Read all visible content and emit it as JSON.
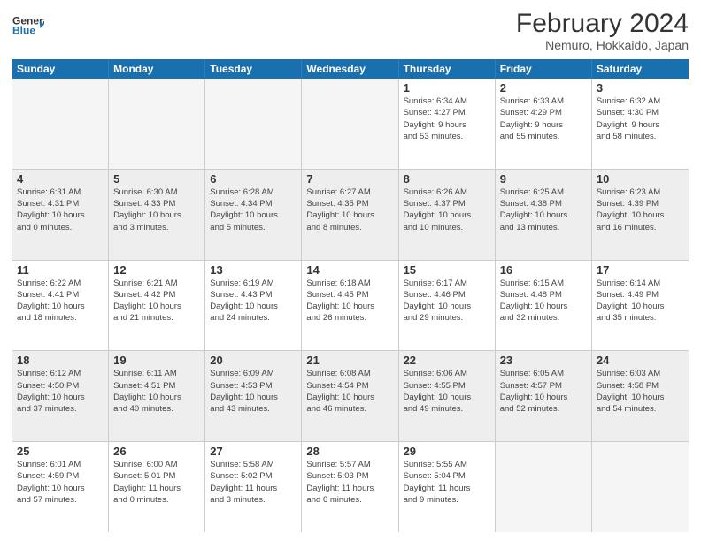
{
  "header": {
    "logo_general": "General",
    "logo_blue": "Blue",
    "title": "February 2024",
    "subtitle": "Nemuro, Hokkaido, Japan"
  },
  "calendar": {
    "days_of_week": [
      "Sunday",
      "Monday",
      "Tuesday",
      "Wednesday",
      "Thursday",
      "Friday",
      "Saturday"
    ],
    "weeks": [
      [
        {
          "day": "",
          "info": "",
          "empty": true
        },
        {
          "day": "",
          "info": "",
          "empty": true
        },
        {
          "day": "",
          "info": "",
          "empty": true
        },
        {
          "day": "",
          "info": "",
          "empty": true
        },
        {
          "day": "1",
          "info": "Sunrise: 6:34 AM\nSunset: 4:27 PM\nDaylight: 9 hours\nand 53 minutes.",
          "empty": false
        },
        {
          "day": "2",
          "info": "Sunrise: 6:33 AM\nSunset: 4:29 PM\nDaylight: 9 hours\nand 55 minutes.",
          "empty": false
        },
        {
          "day": "3",
          "info": "Sunrise: 6:32 AM\nSunset: 4:30 PM\nDaylight: 9 hours\nand 58 minutes.",
          "empty": false
        }
      ],
      [
        {
          "day": "4",
          "info": "Sunrise: 6:31 AM\nSunset: 4:31 PM\nDaylight: 10 hours\nand 0 minutes.",
          "empty": false
        },
        {
          "day": "5",
          "info": "Sunrise: 6:30 AM\nSunset: 4:33 PM\nDaylight: 10 hours\nand 3 minutes.",
          "empty": false
        },
        {
          "day": "6",
          "info": "Sunrise: 6:28 AM\nSunset: 4:34 PM\nDaylight: 10 hours\nand 5 minutes.",
          "empty": false
        },
        {
          "day": "7",
          "info": "Sunrise: 6:27 AM\nSunset: 4:35 PM\nDaylight: 10 hours\nand 8 minutes.",
          "empty": false
        },
        {
          "day": "8",
          "info": "Sunrise: 6:26 AM\nSunset: 4:37 PM\nDaylight: 10 hours\nand 10 minutes.",
          "empty": false
        },
        {
          "day": "9",
          "info": "Sunrise: 6:25 AM\nSunset: 4:38 PM\nDaylight: 10 hours\nand 13 minutes.",
          "empty": false
        },
        {
          "day": "10",
          "info": "Sunrise: 6:23 AM\nSunset: 4:39 PM\nDaylight: 10 hours\nand 16 minutes.",
          "empty": false
        }
      ],
      [
        {
          "day": "11",
          "info": "Sunrise: 6:22 AM\nSunset: 4:41 PM\nDaylight: 10 hours\nand 18 minutes.",
          "empty": false
        },
        {
          "day": "12",
          "info": "Sunrise: 6:21 AM\nSunset: 4:42 PM\nDaylight: 10 hours\nand 21 minutes.",
          "empty": false
        },
        {
          "day": "13",
          "info": "Sunrise: 6:19 AM\nSunset: 4:43 PM\nDaylight: 10 hours\nand 24 minutes.",
          "empty": false
        },
        {
          "day": "14",
          "info": "Sunrise: 6:18 AM\nSunset: 4:45 PM\nDaylight: 10 hours\nand 26 minutes.",
          "empty": false
        },
        {
          "day": "15",
          "info": "Sunrise: 6:17 AM\nSunset: 4:46 PM\nDaylight: 10 hours\nand 29 minutes.",
          "empty": false
        },
        {
          "day": "16",
          "info": "Sunrise: 6:15 AM\nSunset: 4:48 PM\nDaylight: 10 hours\nand 32 minutes.",
          "empty": false
        },
        {
          "day": "17",
          "info": "Sunrise: 6:14 AM\nSunset: 4:49 PM\nDaylight: 10 hours\nand 35 minutes.",
          "empty": false
        }
      ],
      [
        {
          "day": "18",
          "info": "Sunrise: 6:12 AM\nSunset: 4:50 PM\nDaylight: 10 hours\nand 37 minutes.",
          "empty": false
        },
        {
          "day": "19",
          "info": "Sunrise: 6:11 AM\nSunset: 4:51 PM\nDaylight: 10 hours\nand 40 minutes.",
          "empty": false
        },
        {
          "day": "20",
          "info": "Sunrise: 6:09 AM\nSunset: 4:53 PM\nDaylight: 10 hours\nand 43 minutes.",
          "empty": false
        },
        {
          "day": "21",
          "info": "Sunrise: 6:08 AM\nSunset: 4:54 PM\nDaylight: 10 hours\nand 46 minutes.",
          "empty": false
        },
        {
          "day": "22",
          "info": "Sunrise: 6:06 AM\nSunset: 4:55 PM\nDaylight: 10 hours\nand 49 minutes.",
          "empty": false
        },
        {
          "day": "23",
          "info": "Sunrise: 6:05 AM\nSunset: 4:57 PM\nDaylight: 10 hours\nand 52 minutes.",
          "empty": false
        },
        {
          "day": "24",
          "info": "Sunrise: 6:03 AM\nSunset: 4:58 PM\nDaylight: 10 hours\nand 54 minutes.",
          "empty": false
        }
      ],
      [
        {
          "day": "25",
          "info": "Sunrise: 6:01 AM\nSunset: 4:59 PM\nDaylight: 10 hours\nand 57 minutes.",
          "empty": false
        },
        {
          "day": "26",
          "info": "Sunrise: 6:00 AM\nSunset: 5:01 PM\nDaylight: 11 hours\nand 0 minutes.",
          "empty": false
        },
        {
          "day": "27",
          "info": "Sunrise: 5:58 AM\nSunset: 5:02 PM\nDaylight: 11 hours\nand 3 minutes.",
          "empty": false
        },
        {
          "day": "28",
          "info": "Sunrise: 5:57 AM\nSunset: 5:03 PM\nDaylight: 11 hours\nand 6 minutes.",
          "empty": false
        },
        {
          "day": "29",
          "info": "Sunrise: 5:55 AM\nSunset: 5:04 PM\nDaylight: 11 hours\nand 9 minutes.",
          "empty": false
        },
        {
          "day": "",
          "info": "",
          "empty": true
        },
        {
          "day": "",
          "info": "",
          "empty": true
        }
      ]
    ]
  }
}
